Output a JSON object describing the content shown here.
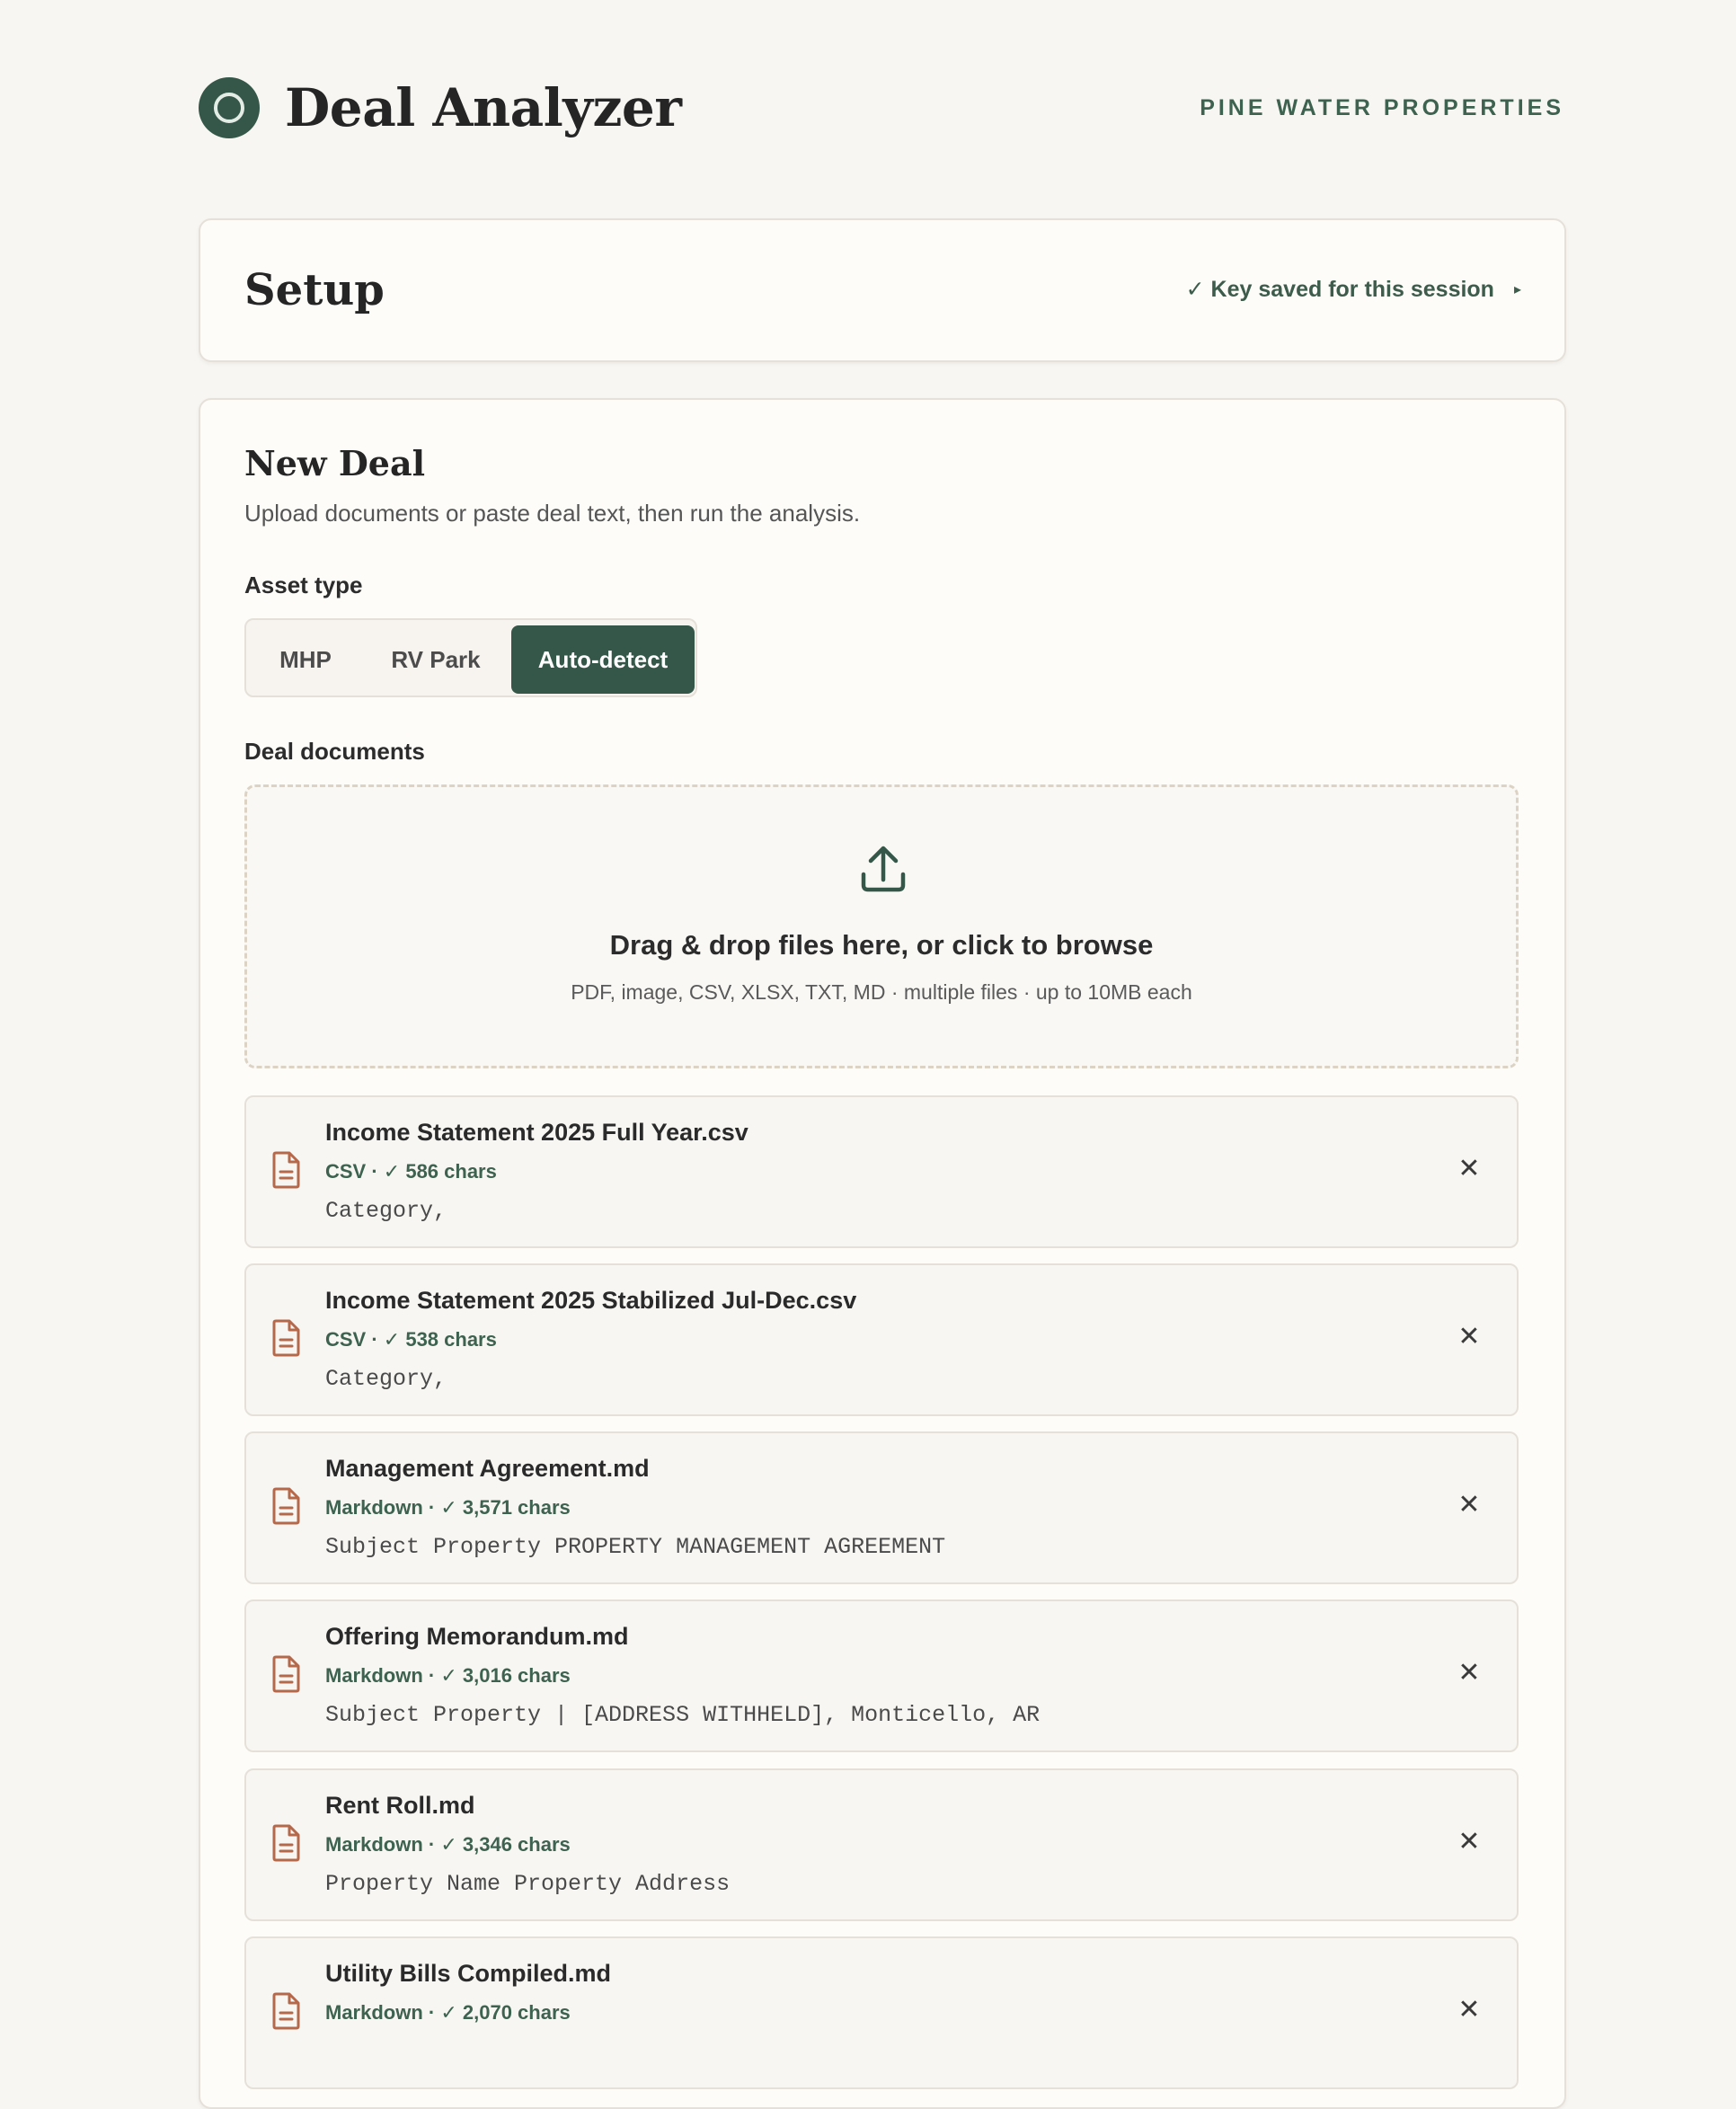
{
  "header": {
    "app_title": "Deal Analyzer",
    "company": "PINE WATER PROPERTIES"
  },
  "setup": {
    "title": "Setup",
    "key_status": "✓ Key saved for this session",
    "expand_glyph": "▸"
  },
  "new_deal": {
    "title": "New Deal",
    "subtitle": "Upload documents or paste deal text, then run the analysis.",
    "asset_type_label": "Asset type",
    "asset_types": [
      "MHP",
      "RV Park",
      "Auto-detect"
    ],
    "selected_asset_type": "Auto-detect",
    "documents_label": "Deal documents",
    "dropzone": {
      "title": "Drag & drop files here, or click to browse",
      "hint": "PDF, image, CSV, XLSX, TXT, MD · multiple files · up to 10MB each"
    },
    "files": [
      {
        "name": "Income Statement 2025 Full Year.csv",
        "meta": "CSV · ✓ 586 chars",
        "preview": "Category,"
      },
      {
        "name": "Income Statement 2025 Stabilized Jul-Dec.csv",
        "meta": "CSV · ✓ 538 chars",
        "preview": "Category,"
      },
      {
        "name": "Management Agreement.md",
        "meta": "Markdown · ✓ 3,571 chars",
        "preview": "Subject Property PROPERTY MANAGEMENT AGREEMENT"
      },
      {
        "name": "Offering Memorandum.md",
        "meta": "Markdown · ✓ 3,016 chars",
        "preview": "Subject Property | [ADDRESS WITHHELD], Monticello, AR"
      },
      {
        "name": "Rent Roll.md",
        "meta": "Markdown · ✓ 3,346 chars",
        "preview": "Property Name Property Address"
      },
      {
        "name": "Utility Bills Compiled.md",
        "meta": "Markdown · ✓ 2,070 chars",
        "preview": ""
      }
    ],
    "remove_glyph": "✕"
  },
  "colors": {
    "accent": "#34574a",
    "accent_text": "#3d6350",
    "file_icon": "#b5694a",
    "background": "#f8f6f2"
  }
}
